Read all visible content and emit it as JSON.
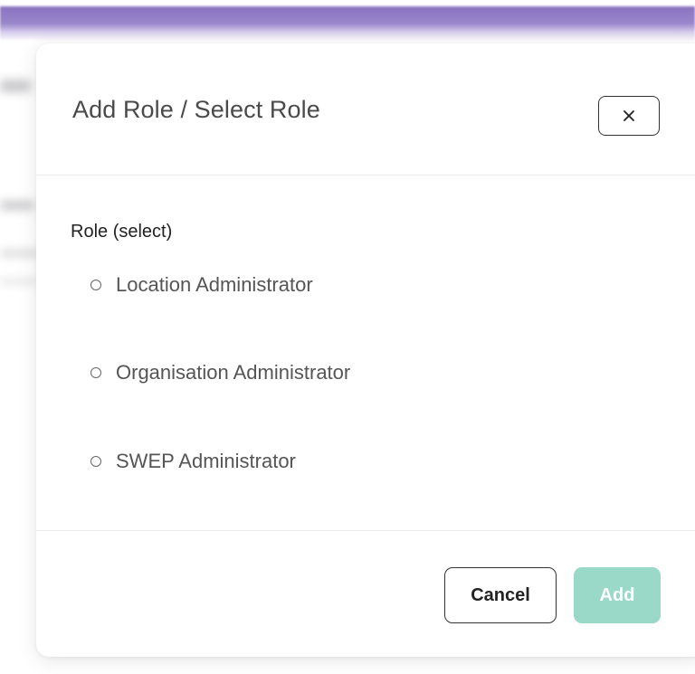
{
  "modal": {
    "title": "Add Role / Select Role",
    "close_icon": "close-icon",
    "field_label": "Role (select)",
    "options": [
      {
        "label": "Location Administrator",
        "selected": false
      },
      {
        "label": "Organisation Administrator",
        "selected": false
      },
      {
        "label": "SWEP Administrator",
        "selected": false
      }
    ],
    "cancel_label": "Cancel",
    "add_label": "Add",
    "add_disabled": true
  },
  "colors": {
    "header_band": "#9a87cc",
    "add_button": "#9ad8c8",
    "title_text": "#4a4a4a"
  }
}
